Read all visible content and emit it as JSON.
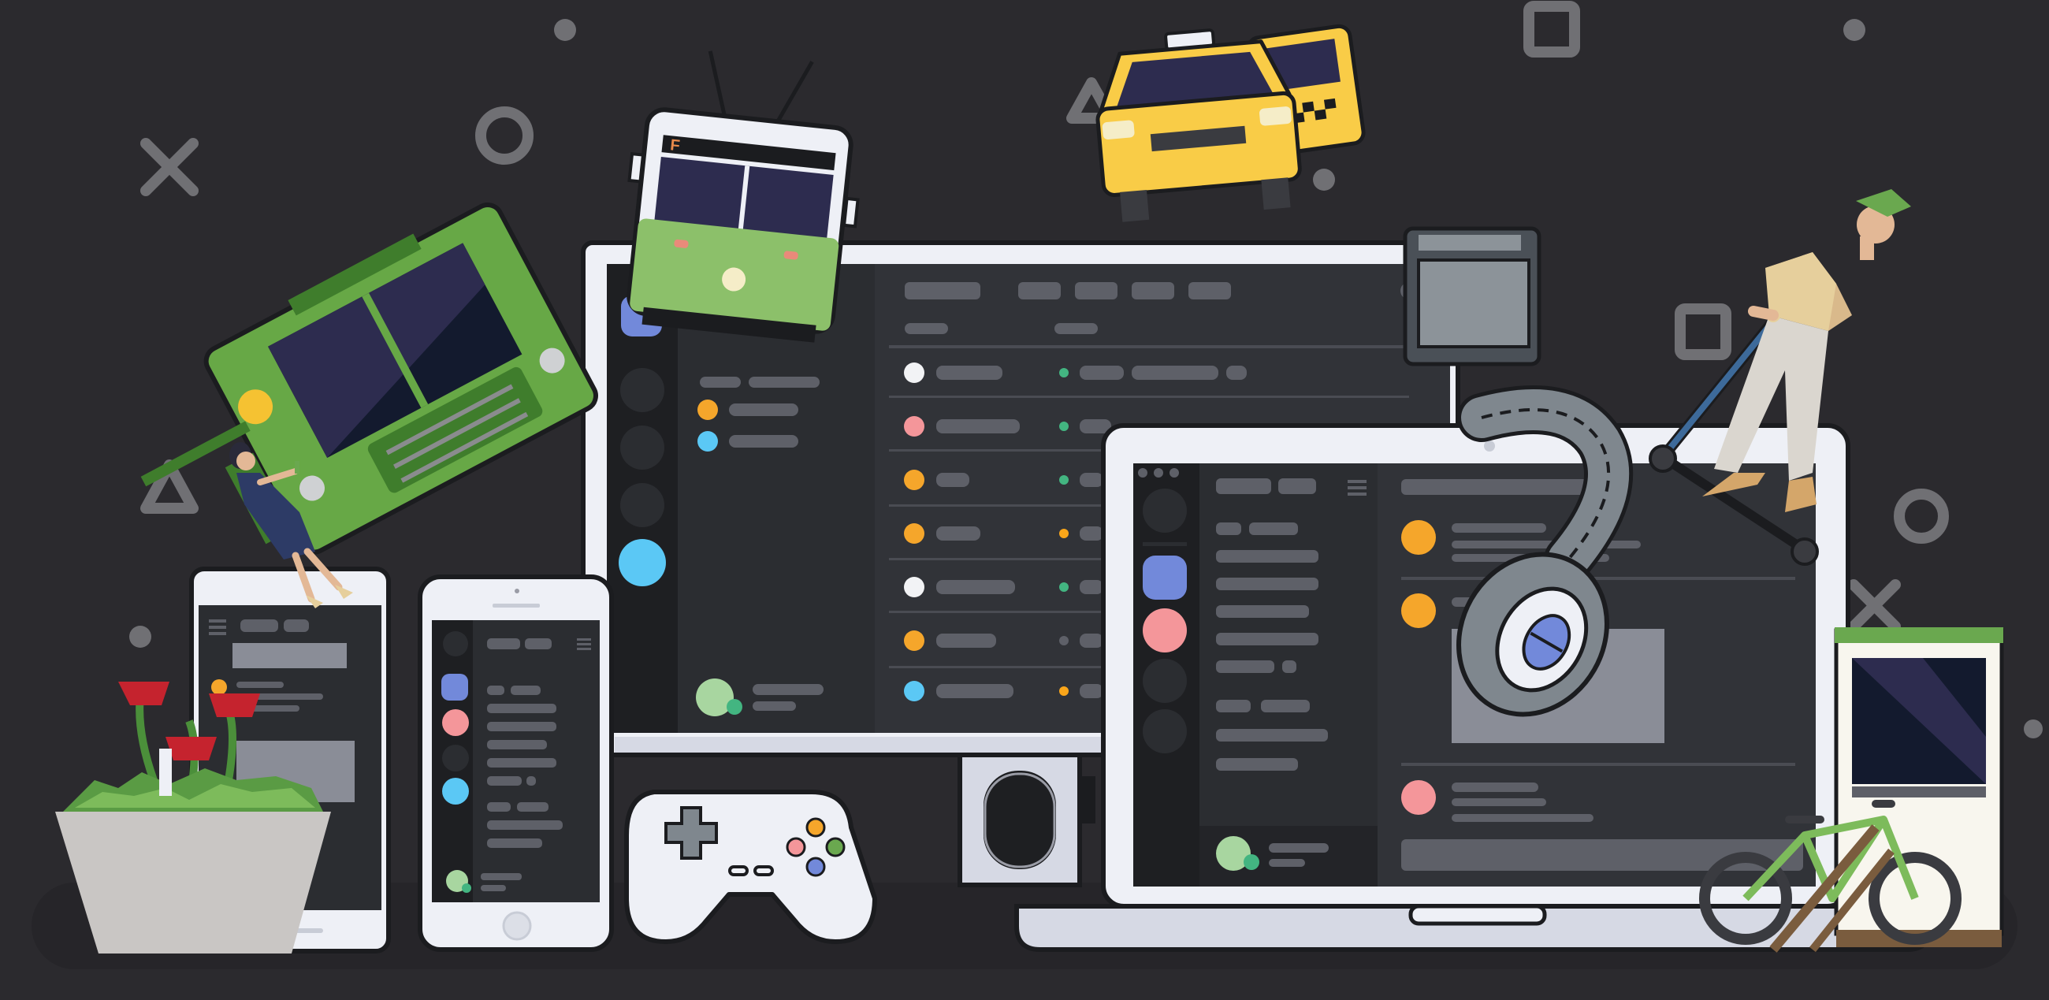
{
  "scene": {
    "subject": "devices-illustration",
    "texts": {
      "tram_route_letter": "F"
    },
    "icons": [
      "cross-shape-icon",
      "circle-shape-icon",
      "triangle-shape-icon",
      "square-shape-icon",
      "dot-shape-icon",
      "tram-icon",
      "taxi-icon",
      "food-truck-icon",
      "headphones-icon",
      "gamepad-icon",
      "bicycle-icon",
      "plant-pot-icon",
      "scooter-rider-icon",
      "person-icon"
    ]
  },
  "colors": {
    "background": "#2b2a2e",
    "shape_gray": "#707074",
    "device_frame": "#eef0f6",
    "device_outline": "#1b1c1f",
    "screen_sidebar": "#1e1f22",
    "screen_channels": "#2b2d31",
    "screen_chat": "#313338",
    "blurple": "#7289da",
    "green_status": "#43b581",
    "yellow_status": "#faa61a",
    "orange_avatar": "#f5a62b",
    "pink_avatar": "#f4969a",
    "cyan_avatar": "#5bc8f5",
    "white_avatar": "#f2f3f5",
    "pill_gray": "#5e6068",
    "tram_green": "#8cc06a",
    "truck_green": "#67a846",
    "taxi_yellow": "#f9cc47",
    "window_navy": "#2d2c4f",
    "flower_red": "#c5232e",
    "pot_gray": "#c9c6c4"
  }
}
